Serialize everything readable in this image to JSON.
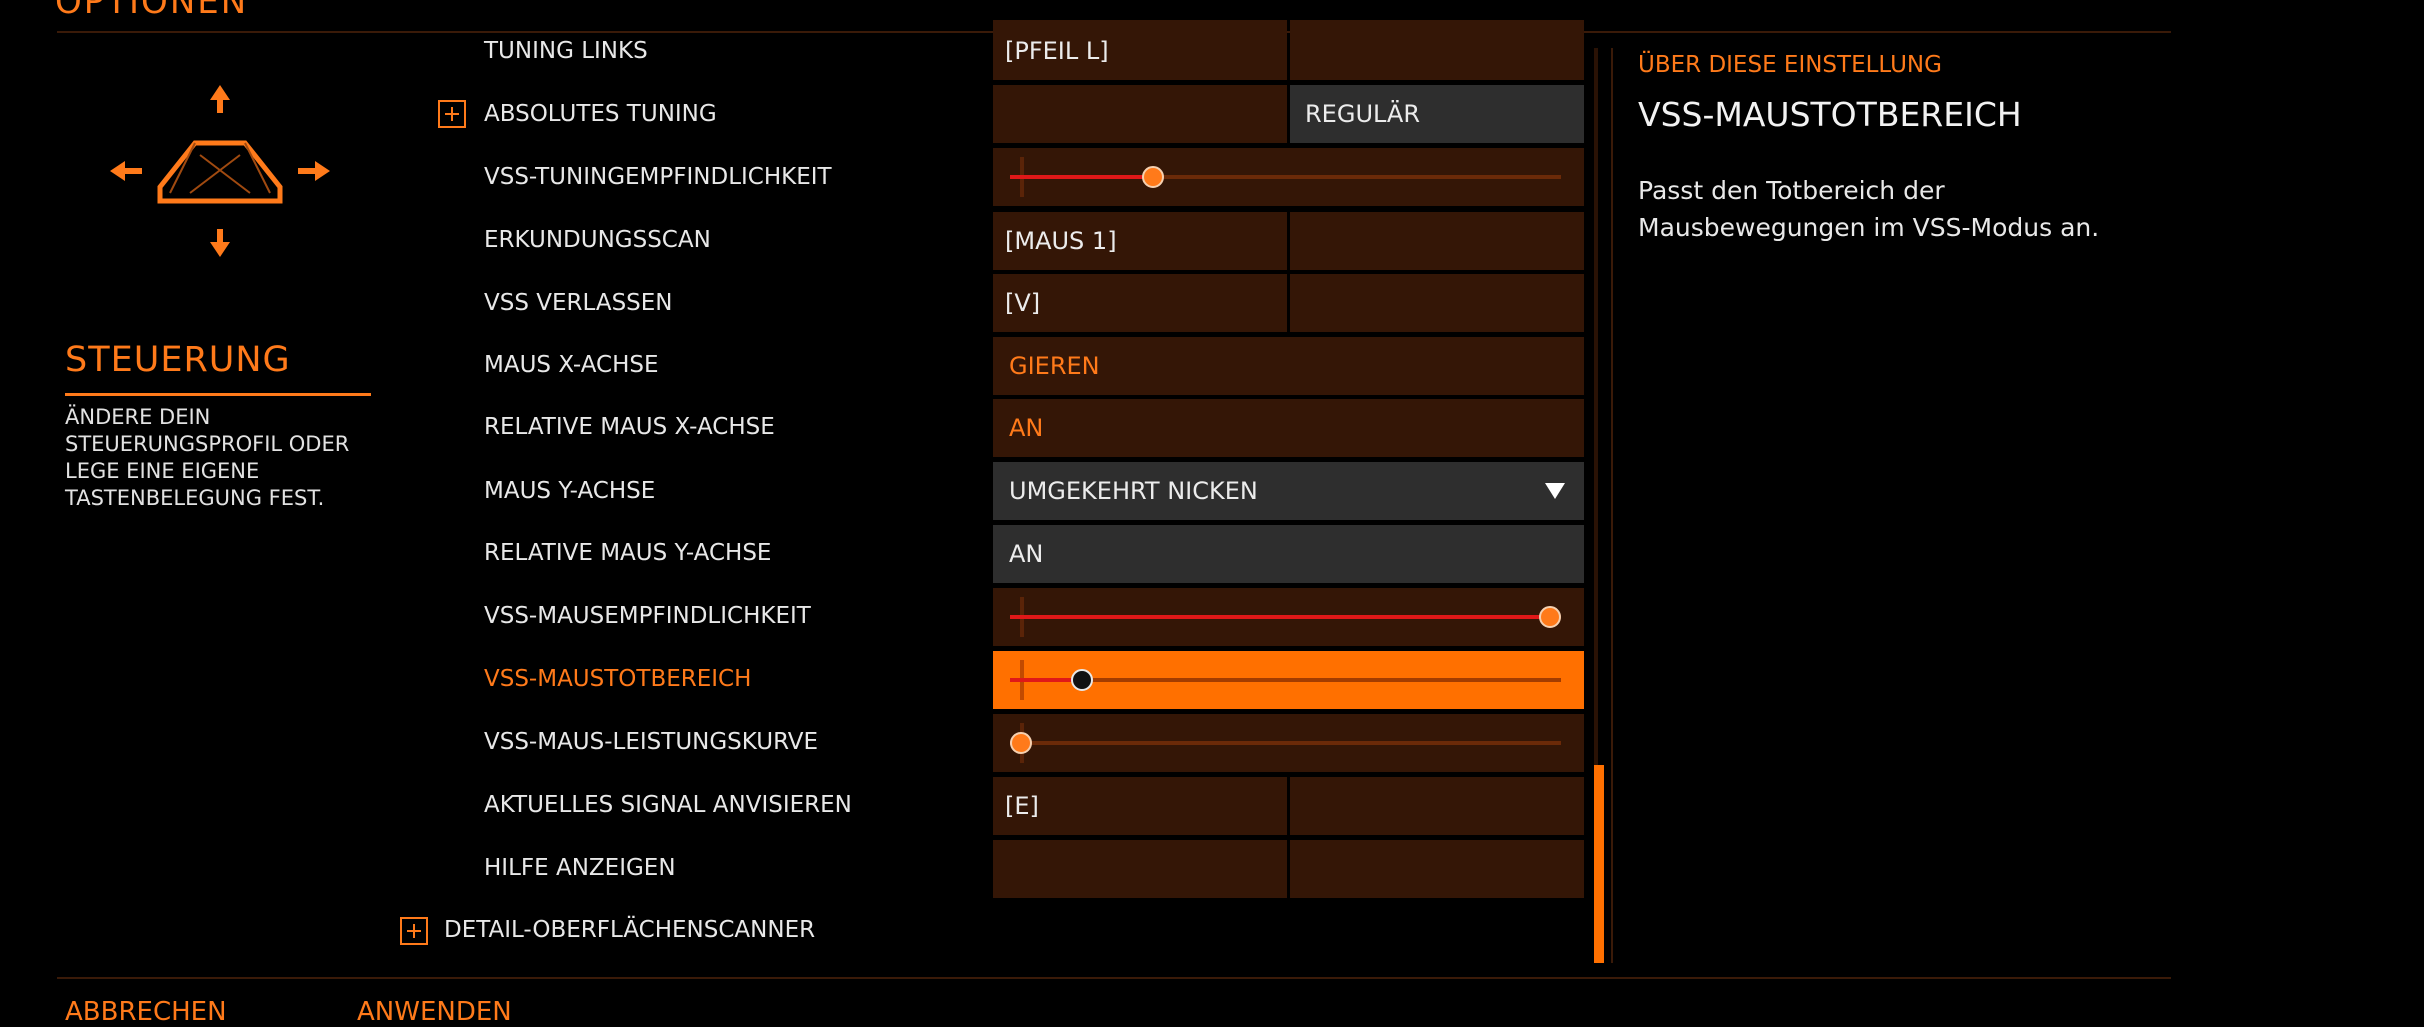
{
  "header": {
    "title": "OPTIONEN"
  },
  "section": {
    "title": "STEUERUNG",
    "description": "ÄNDERE DEIN STEUERUNGSPROFIL ODER LEGE EINE EIGENE TASTENBELEGUNG FEST."
  },
  "rows": {
    "tuning_links": {
      "label": "TUNING LINKS",
      "primary": "[PFEIL L]",
      "secondary": ""
    },
    "absolutes_tuning": {
      "label": "ABSOLUTES TUNING",
      "primary": "",
      "secondary": "REGULÄR"
    },
    "tuningempfindlichkeit": {
      "label": "VSS-TUNINGEMPFINDLICHKEIT",
      "value": 0.26
    },
    "erkundungsscan": {
      "label": "ERKUNDUNGSSCAN",
      "primary": "[MAUS 1]",
      "secondary": ""
    },
    "vss_verlassen": {
      "label": "VSS VERLASSEN",
      "primary": "[V]",
      "secondary": ""
    },
    "maus_x": {
      "label": "MAUS X-ACHSE",
      "value": "GIEREN"
    },
    "rel_maus_x": {
      "label": "RELATIVE MAUS X-ACHSE",
      "value": "AN"
    },
    "maus_y": {
      "label": "MAUS Y-ACHSE",
      "value": "UMGEKEHRT NICKEN"
    },
    "rel_maus_y": {
      "label": "RELATIVE MAUS Y-ACHSE",
      "value": "AN"
    },
    "mausempfindlichkeit": {
      "label": "VSS-MAUSEMPFINDLICHKEIT",
      "value": 0.98
    },
    "maustotbereich": {
      "label": "VSS-MAUSTOTBEREICH",
      "value": 0.13
    },
    "leistungskurve": {
      "label": "VSS-MAUS-LEISTUNGSKURVE",
      "value": 0.02
    },
    "signal_anvisieren": {
      "label": "AKTUELLES SIGNAL ANVISIEREN",
      "primary": "[E]",
      "secondary": ""
    },
    "hilfe": {
      "label": "HILFE ANZEIGEN",
      "primary": "",
      "secondary": ""
    }
  },
  "group_detail": {
    "label": "DETAIL-OBERFLÄCHENSCANNER"
  },
  "info": {
    "heading": "ÜBER DIESE EINSTELLUNG",
    "title": "VSS-MAUSTOTBEREICH",
    "text": "Passt den Totbereich der Mausbewegungen im VSS-Modus an."
  },
  "footer": {
    "cancel": "ABBRECHEN",
    "apply": "ANWENDEN"
  },
  "colors": {
    "accent": "#ff7a1a",
    "cell_bg": "#341606",
    "slider_fill": "#e01818"
  }
}
